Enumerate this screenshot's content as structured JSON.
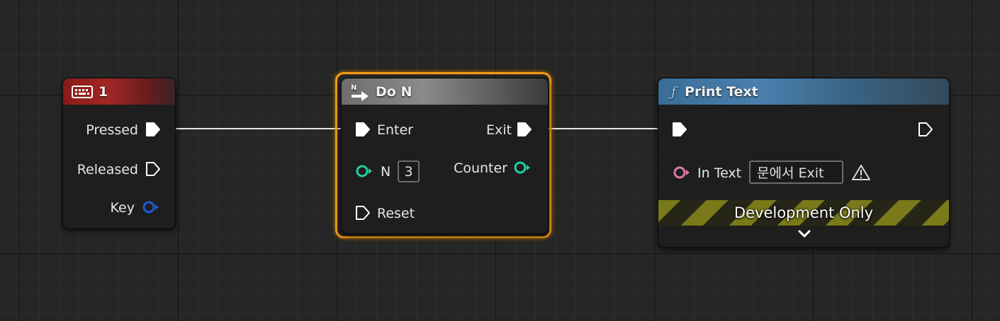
{
  "key_node": {
    "title": "1",
    "icon": "keyboard-icon",
    "header_color": "#a32626",
    "pins": {
      "pressed": "Pressed",
      "released": "Released",
      "key": "Key"
    }
  },
  "don_node": {
    "title": "Do N",
    "icon": "do-n-icon",
    "icon_letter": "N",
    "selected_outline_color": "#f39c12",
    "pins": {
      "enter": "Enter",
      "n": "N",
      "n_value": "3",
      "reset": "Reset",
      "exit": "Exit",
      "counter": "Counter"
    }
  },
  "print_node": {
    "title": "Print Text",
    "icon": "function-icon",
    "icon_glyph": "ƒ",
    "header_color": "#4a7fad",
    "pins": {
      "in_text": "In Text",
      "in_text_value": "문에서 Exit"
    },
    "development_only": "Development Only",
    "warning_icon": "warning-icon",
    "expand_icon": "chevron-down-icon"
  },
  "colors": {
    "exec": "#ffffff",
    "int_pin": "#1fd3a2",
    "struct_pin": "#1f5ad9",
    "text_pin": "#e07aa6"
  }
}
